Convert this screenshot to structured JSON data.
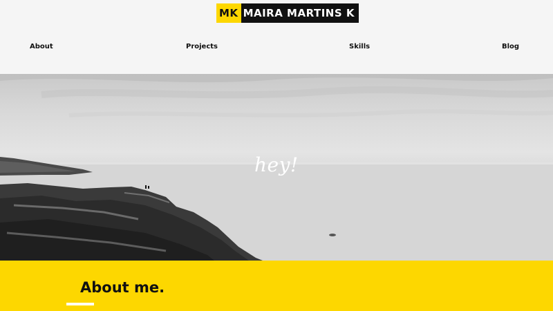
{
  "header": {
    "logo_initials": "MK",
    "logo_name": "MAIRA MARTINS K"
  },
  "nav": {
    "about": "About",
    "projects": "Projects",
    "skills": "Skills",
    "blog": "Blog"
  },
  "hero": {
    "greeting": "hey!"
  },
  "about_section": {
    "title": "About me."
  },
  "colors": {
    "accent": "#fdd700",
    "dark": "#111111",
    "background": "#f5f5f5"
  }
}
